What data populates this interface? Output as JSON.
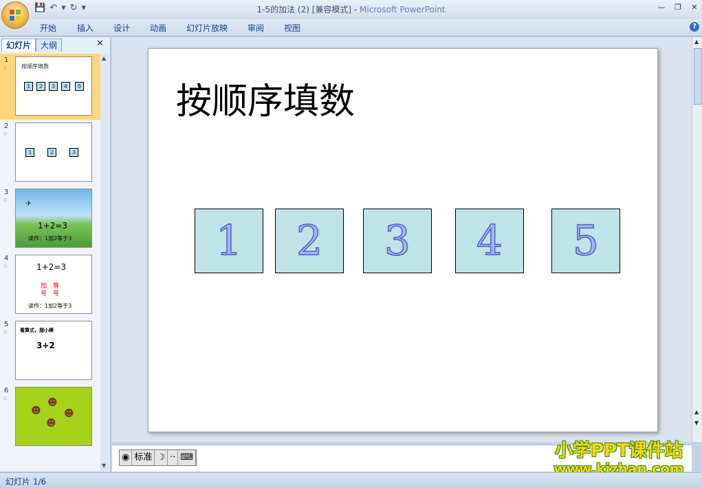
{
  "window": {
    "title_doc": "1-5的加法 (2) [兼容模式] - ",
    "title_app": "Microsoft PowerPoint"
  },
  "ribbon": {
    "tabs": [
      "开始",
      "插入",
      "设计",
      "动画",
      "幻灯片放映",
      "审阅",
      "视图"
    ]
  },
  "left_panel": {
    "tab_slides": "幻灯片",
    "tab_outline": "大纲",
    "thumbnails": [
      {
        "num": "1",
        "title": "按顺序填数",
        "boxes": [
          "1",
          "2",
          "3",
          "4",
          "5"
        ]
      },
      {
        "num": "2",
        "boxes": [
          "1",
          "2",
          "3"
        ]
      },
      {
        "num": "3",
        "equation": "1+2=3",
        "caption": "读作：1加2等于3"
      },
      {
        "num": "4",
        "equation": "1+2=3",
        "label_plus": "加号",
        "label_equal": "等号",
        "caption": "读作：1加2等于3"
      },
      {
        "num": "5",
        "title": "看算式，摆小棒",
        "equation": "3+2"
      },
      {
        "num": "6"
      }
    ]
  },
  "slide": {
    "title": "按顺序填数",
    "boxes": [
      "1",
      "2",
      "3",
      "4",
      "5"
    ]
  },
  "ime": {
    "mode": "标准"
  },
  "watermark": {
    "line1": "小学PPT课件站",
    "line2": "www.kjzhan.com"
  },
  "status": {
    "slide_counter": "幻灯片 1/6"
  }
}
